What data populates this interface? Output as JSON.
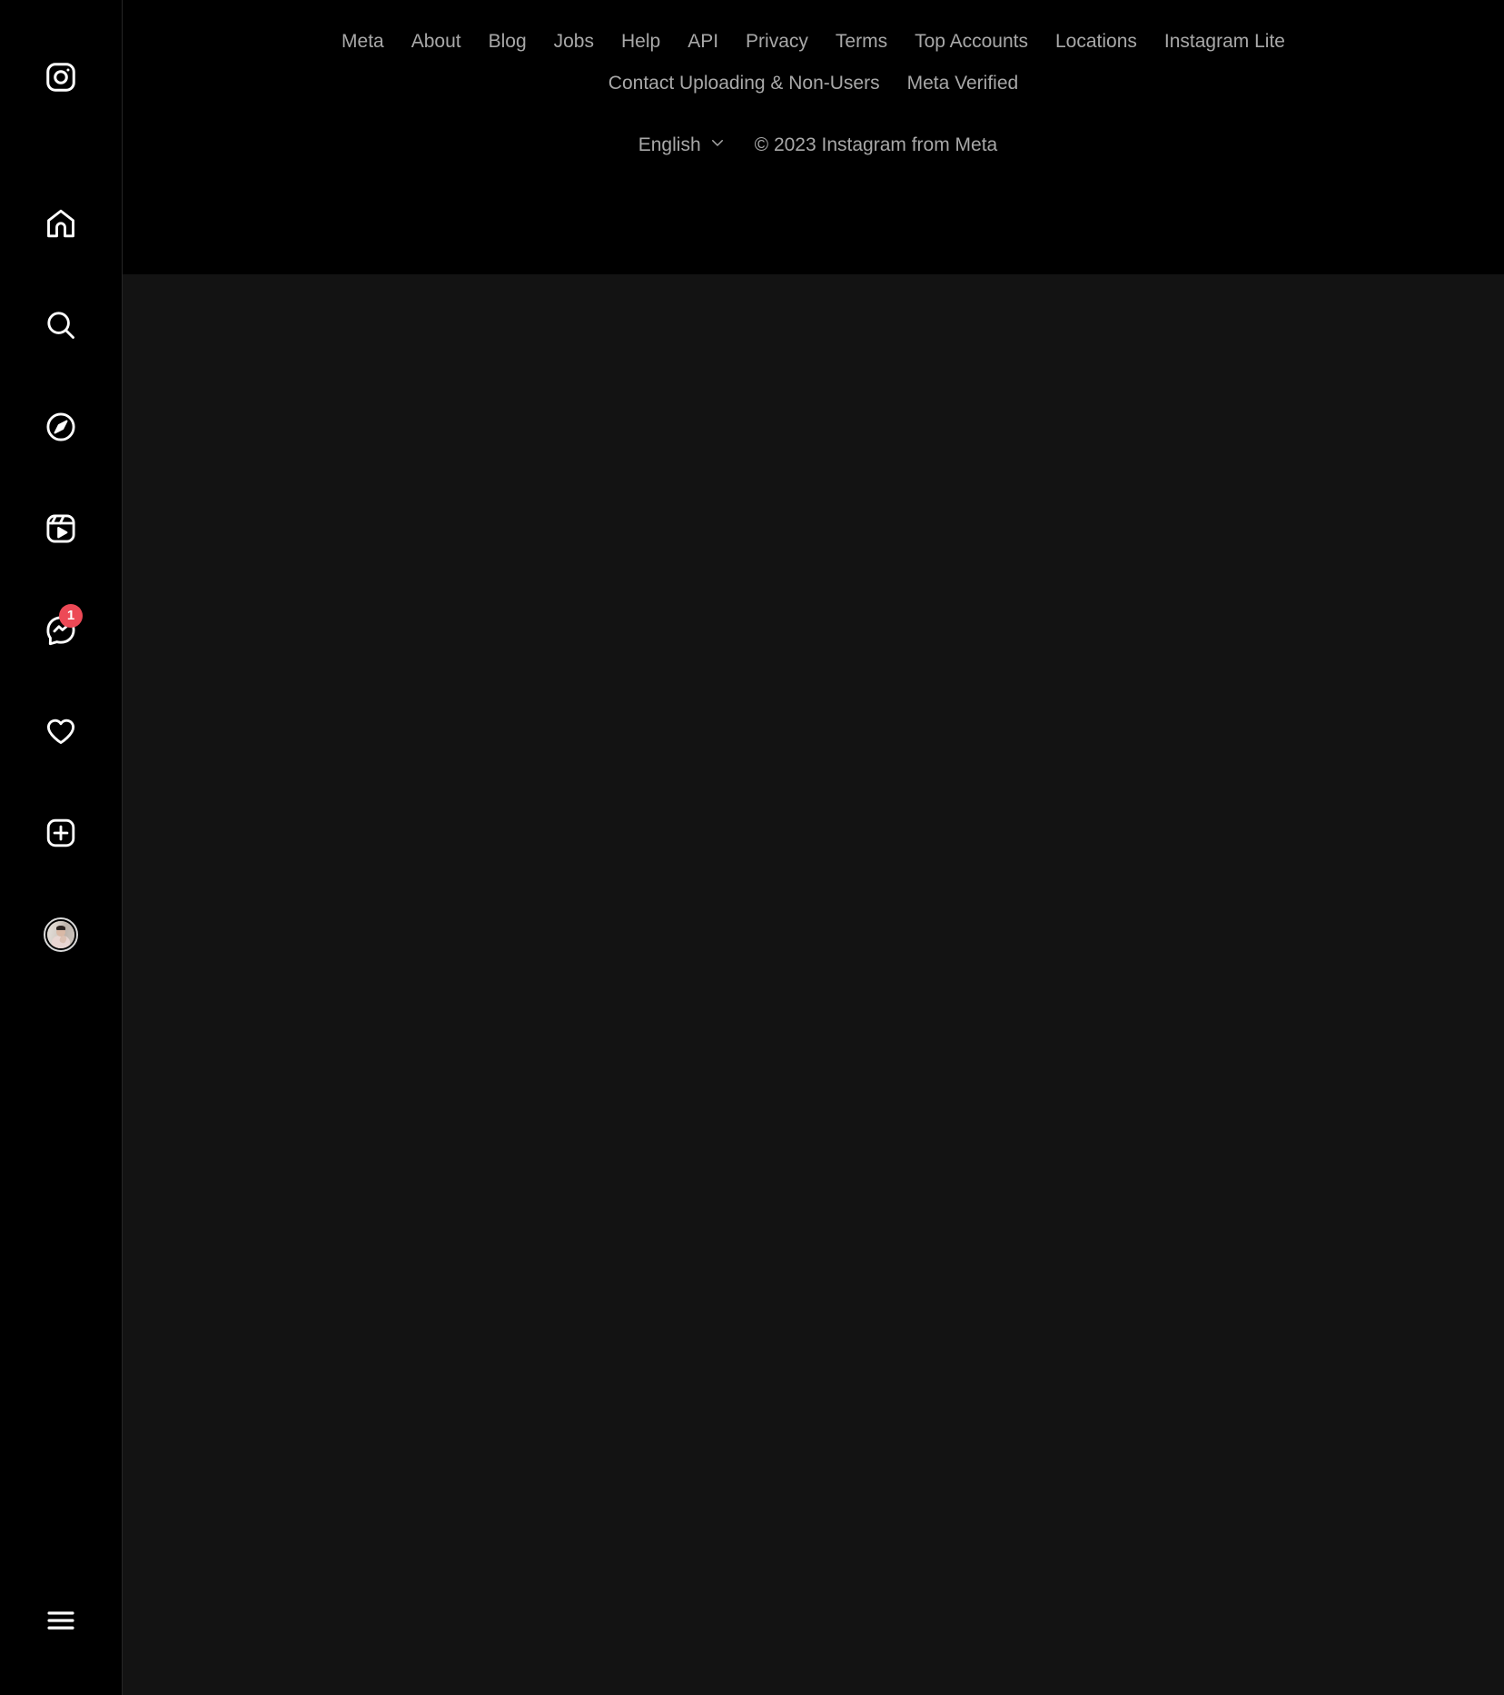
{
  "app": {
    "title": "Instagram",
    "theme": "dark",
    "colors": {
      "background": "#000000",
      "content_background": "#131313",
      "sidebar_background": "#000000",
      "border": "#262626",
      "muted_text": "#a8a8a8",
      "badge": "#ED4956",
      "icon": "#ffffff"
    }
  },
  "sidebar": {
    "brand": {
      "icon": "instagram-camera-logo",
      "label": "Instagram"
    },
    "items": [
      {
        "icon": "home-icon",
        "label": "Home"
      },
      {
        "icon": "search-icon",
        "label": "Search"
      },
      {
        "icon": "compass-icon",
        "label": "Explore"
      },
      {
        "icon": "reels-icon",
        "label": "Reels"
      },
      {
        "icon": "messenger-icon",
        "label": "Messages",
        "badge": "1"
      },
      {
        "icon": "heart-icon",
        "label": "Notifications"
      },
      {
        "icon": "plus-square-icon",
        "label": "Create"
      },
      {
        "icon": "avatar-icon",
        "label": "Profile"
      }
    ],
    "more": {
      "icon": "hamburger-icon",
      "label": "More"
    }
  },
  "footer": {
    "row1": [
      "Meta",
      "About",
      "Blog",
      "Jobs",
      "Help",
      "API",
      "Privacy",
      "Terms",
      "Top Accounts",
      "Locations",
      "Instagram Lite"
    ],
    "row2": [
      "Contact Uploading & Non-Users",
      "Meta Verified"
    ],
    "language": {
      "value": "English",
      "chevron_icon": "chevron-down-icon"
    },
    "copyright": "© 2023 Instagram from Meta"
  }
}
